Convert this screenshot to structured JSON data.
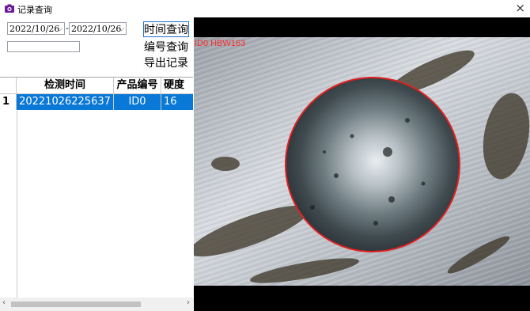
{
  "window": {
    "title": "记录查询",
    "close_glyph": "×"
  },
  "filters": {
    "start_date": "2022/10/26",
    "end_date": "2022/10/26",
    "date_separator": "-",
    "chevron": "⌵",
    "id_value": "",
    "buttons": {
      "time_query": "时间查询",
      "id_query": "编号查询",
      "export": "导出记录"
    }
  },
  "table": {
    "columns": [
      "检测时间",
      "产品编号",
      "硬度"
    ],
    "rows": [
      {
        "index": "1",
        "time": "20221026225637",
        "id": "ID0",
        "hardness": "16"
      }
    ]
  },
  "scrollbar": {
    "left": "‹",
    "right": "›"
  },
  "viewer": {
    "overlay_label": "ID0 HBW163"
  },
  "colors": {
    "selection": "#0a78d7",
    "accent_border": "#1e73c9",
    "label": "#ff2a2a"
  }
}
